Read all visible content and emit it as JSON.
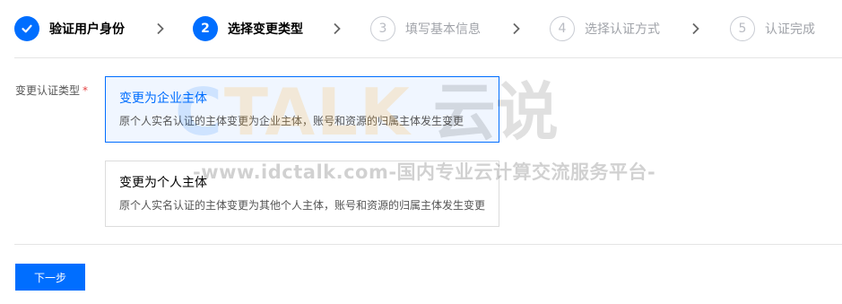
{
  "steps": [
    {
      "number": "1",
      "label": "验证用户身份",
      "state": "done"
    },
    {
      "number": "2",
      "label": "选择变更类型",
      "state": "active"
    },
    {
      "number": "3",
      "label": "填写基本信息",
      "state": "pending"
    },
    {
      "number": "4",
      "label": "选择认证方式",
      "state": "pending"
    },
    {
      "number": "5",
      "label": "认证完成",
      "state": "pending"
    }
  ],
  "form": {
    "label": "变更认证类型",
    "required_mark": "*",
    "options": [
      {
        "title": "变更为企业主体",
        "description": "原个人实名认证的主体变更为企业主体，账号和资源的归属主体发生变更",
        "selected": true
      },
      {
        "title": "变更为个人主体",
        "description": "原个人实名认证的主体变更为其他个人主体，账号和资源的归属主体发生变更",
        "selected": false
      }
    ]
  },
  "next_button": "下一步",
  "watermark": {
    "logo_text_a": "C",
    "logo_text_b": "TALK",
    "cn_text": "云说",
    "url": "-www.idctalk.com-国内专业云计算交流服务平台-"
  },
  "colors": {
    "accent": "#006eff",
    "selected_bg": "#f0f6ff",
    "required": "#e54545"
  }
}
